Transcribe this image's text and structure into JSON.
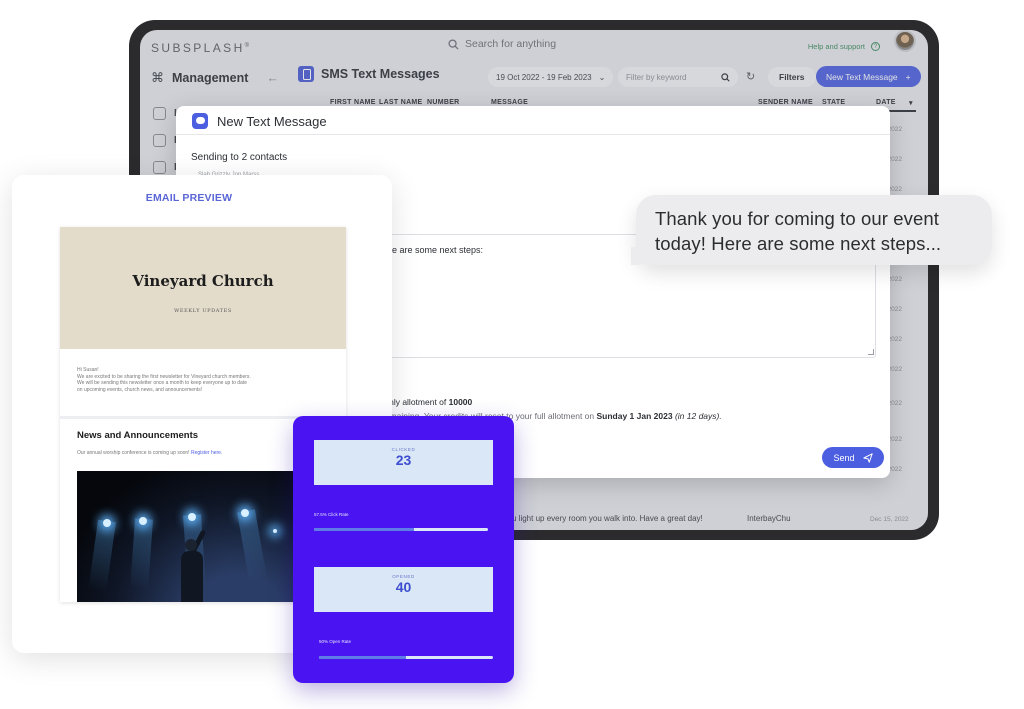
{
  "app": {
    "brand": "SUBSPLASH",
    "brand_mark": "®",
    "search_placeholder": "Search for anything",
    "help_label": "Help and support",
    "help_icon": "?",
    "section": "Management",
    "sidebar_items": [
      {
        "icon": "home-icon",
        "label": "H"
      },
      {
        "icon": "people-icon",
        "label": "P"
      },
      {
        "icon": "calendar-icon",
        "label": "E"
      }
    ]
  },
  "sms_page": {
    "title": "SMS Text Messages",
    "date_range": "19 Oct 2022 - 19 Feb 2023",
    "keyword_placeholder": "Filter by keyword",
    "filters_label": "Filters",
    "new_button_label": "New Text Message",
    "columns": [
      "FIRST NAME",
      "LAST NAME",
      "NUMBER",
      "MESSAGE",
      "SENDER NAME",
      "STATE",
      "DATE"
    ],
    "row_dates": [
      "2022",
      "2022",
      "2022",
      "2022",
      "2022",
      "2022",
      "2022",
      "2022",
      "2022",
      "2022",
      "2022"
    ],
    "last_row": {
      "message": "u light up every room you walk into. Have a great day!",
      "sender": "InterbayChu",
      "date": "Dec 15, 2022"
    }
  },
  "modal": {
    "title": "New Text Message",
    "sending_to": "Sending to 2 contacts",
    "chips": "Slab Grizzly        Jon Marss",
    "message_fragment": "ere are some next steps:",
    "allotment_prefix": "nthly allotment of ",
    "allotment_value": "10000",
    "reset_prefix": "remaining. Your credits will reset to your full allotment on ",
    "reset_date": "Sunday 1 Jan 2023",
    "reset_suffix": " (in 12 days).",
    "send_label": "Send"
  },
  "bubble": {
    "text": "Thank you for coming to our event today! Here are some next steps..."
  },
  "email_preview": {
    "heading": "EMAIL PREVIEW",
    "church_name": "Vineyard Church",
    "subtitle": "WEEKLY UPDATES",
    "greeting_line1": "Hi Susan!",
    "greeting_line2": "We are excited to be sharing the first newsletter for Vineyard church members.",
    "greeting_line3": "We will be sending this newsletter once a month to keep everyone up to date",
    "greeting_line4": "on upcoming events, church news, and announcements!",
    "news_heading": "News and Announcements",
    "conference_text": "Our annual worship conference is coming up soon! ",
    "register_link": "Register here."
  },
  "stats": {
    "clicked_label": "CLICKED",
    "clicked_value": "23",
    "click_rate_label": "57.5% Click Rate",
    "click_rate": 0.575,
    "opened_label": "OPENED",
    "opened_value": "40",
    "open_rate_label": "50% Open Rate",
    "open_rate": 0.5
  },
  "colors": {
    "accent": "#4c5fe0",
    "stats_bg": "#4a14f2",
    "email_heading": "#5a66d6"
  }
}
